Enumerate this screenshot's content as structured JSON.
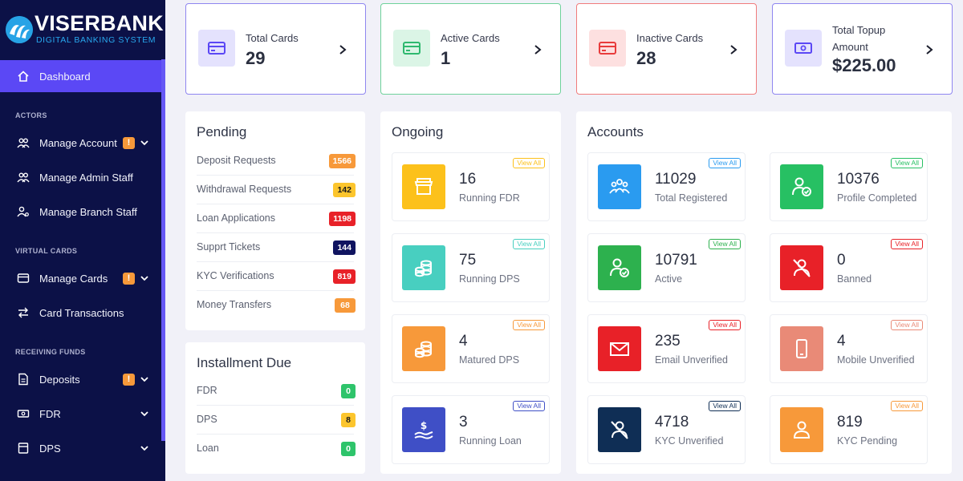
{
  "brand": {
    "title": "VISERBANK",
    "subtitle": "DIGITAL BANKING SYSTEM"
  },
  "sidebar": {
    "dashboard": "Dashboard",
    "sections": [
      "ACTORS",
      "VIRTUAL CARDS",
      "RECEIVING FUNDS"
    ],
    "items": [
      {
        "label": "Manage Account",
        "warn": "!"
      },
      {
        "label": "Manage Admin Staff"
      },
      {
        "label": "Manage Branch Staff"
      },
      {
        "label": "Manage Cards",
        "warn": "!"
      },
      {
        "label": "Card Transactions"
      },
      {
        "label": "Deposits",
        "warn": "!"
      },
      {
        "label": "FDR"
      },
      {
        "label": "DPS"
      }
    ]
  },
  "stats": [
    {
      "label": "Total Cards",
      "value": "29",
      "color": "#6a5cf6"
    },
    {
      "label": "Active Cards",
      "value": "1",
      "color": "#3ec28a"
    },
    {
      "label": "Inactive Cards",
      "value": "28",
      "color": "#ef5a5a"
    },
    {
      "label_line1": "Total Topup",
      "label_line2": "Amount",
      "value": "$225.00",
      "color": "#6a5cf6"
    }
  ],
  "pending": {
    "title": "Pending",
    "rows": [
      {
        "label": "Deposit Requests",
        "count": "1566",
        "color": "#f7993a"
      },
      {
        "label": "Withdrawal Requests",
        "count": "142",
        "color": "#fcc52d"
      },
      {
        "label": "Loan Applications",
        "count": "1198",
        "color": "#e82128"
      },
      {
        "label": "Supprt Tickets",
        "count": "144",
        "color": "#101460"
      },
      {
        "label": "KYC Verifications",
        "count": "819",
        "color": "#e82128"
      },
      {
        "label": "Money Transfers",
        "count": "68",
        "color": "#f7993a"
      }
    ]
  },
  "installment": {
    "title": "Installment Due",
    "rows": [
      {
        "label": "FDR",
        "count": "0",
        "color": "#2ec46b"
      },
      {
        "label": "DPS",
        "count": "8",
        "color": "#fcc52d"
      },
      {
        "label": "Loan",
        "count": "0",
        "color": "#2ec46b"
      }
    ]
  },
  "ongoing": {
    "title": "Ongoing",
    "view_all": "View All",
    "tiles": [
      {
        "value": "16",
        "label": "Running FDR",
        "color": "#fcc11b",
        "icon": "store-icon"
      },
      {
        "value": "75",
        "label": "Running DPS",
        "color": "#48cfc0",
        "icon": "coins-icon"
      },
      {
        "value": "4",
        "label": "Matured DPS",
        "color": "#f7993a",
        "icon": "coins-icon"
      },
      {
        "value": "3",
        "label": "Running Loan",
        "color": "#3f4fc6",
        "icon": "loan-hand-icon"
      }
    ]
  },
  "accounts": {
    "title": "Accounts",
    "view_all": "View All",
    "tiles": [
      {
        "value": "11029",
        "label": "Total Registered",
        "color": "#2a9bf0",
        "icon": "users-group-icon"
      },
      {
        "value": "10376",
        "label": "Profile Completed",
        "color": "#27c063",
        "icon": "user-check-icon"
      },
      {
        "value": "10791",
        "label": "Active",
        "color": "#2db14e",
        "icon": "user-check-icon"
      },
      {
        "value": "0",
        "label": "Banned",
        "color": "#e82128",
        "icon": "user-ban-icon"
      },
      {
        "value": "235",
        "label": "Email Unverified",
        "color": "#e82128",
        "icon": "envelope-icon"
      },
      {
        "value": "4",
        "label": "Mobile Unverified",
        "color": "#e98a77",
        "icon": "mobile-icon"
      },
      {
        "value": "4718",
        "label": "KYC Unverified",
        "color": "#0f2e55",
        "icon": "user-ban-icon"
      },
      {
        "value": "819",
        "label": "KYC Pending",
        "color": "#f7993a",
        "icon": "user-icon"
      }
    ]
  }
}
